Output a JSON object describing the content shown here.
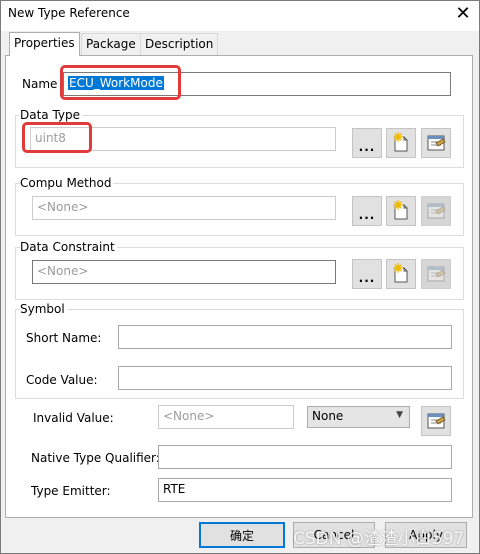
{
  "window": {
    "title": "New Type Reference",
    "close_symbol": "✕"
  },
  "tabs": [
    {
      "label": "Properties"
    },
    {
      "label": "Package"
    },
    {
      "label": "Description"
    }
  ],
  "name": {
    "label": "Name",
    "value": "ECU_WorkMode"
  },
  "data_type": {
    "label": "Data Type",
    "value": "uint8",
    "browse_label": "..."
  },
  "compu_method": {
    "label": "Compu Method",
    "value": "<None>",
    "browse_label": "..."
  },
  "data_constraint": {
    "label": "Data Constraint",
    "value": "<None>",
    "browse_label": "..."
  },
  "symbol": {
    "label": "Symbol",
    "short_name_label": "Short Name:",
    "short_name_value": "",
    "code_value_label": "Code Value:",
    "code_value_value": ""
  },
  "invalid_value": {
    "label": "Invalid Value:",
    "value": "<None>",
    "option_selected": "None"
  },
  "native_type_qualifier": {
    "label": "Native Type Qualifier:",
    "value": ""
  },
  "type_emitter": {
    "label": "Type Emitter:",
    "value": "RTE"
  },
  "buttons": {
    "ok": "确定",
    "cancel": "Cancel",
    "apply": "Apply"
  },
  "watermark": "CSDN @渣渣小白597",
  "colors": {
    "highlight": "#e03a3a",
    "selection": "#0078d7",
    "panel": "#ffffff",
    "dialog": "#f0f0f0"
  }
}
